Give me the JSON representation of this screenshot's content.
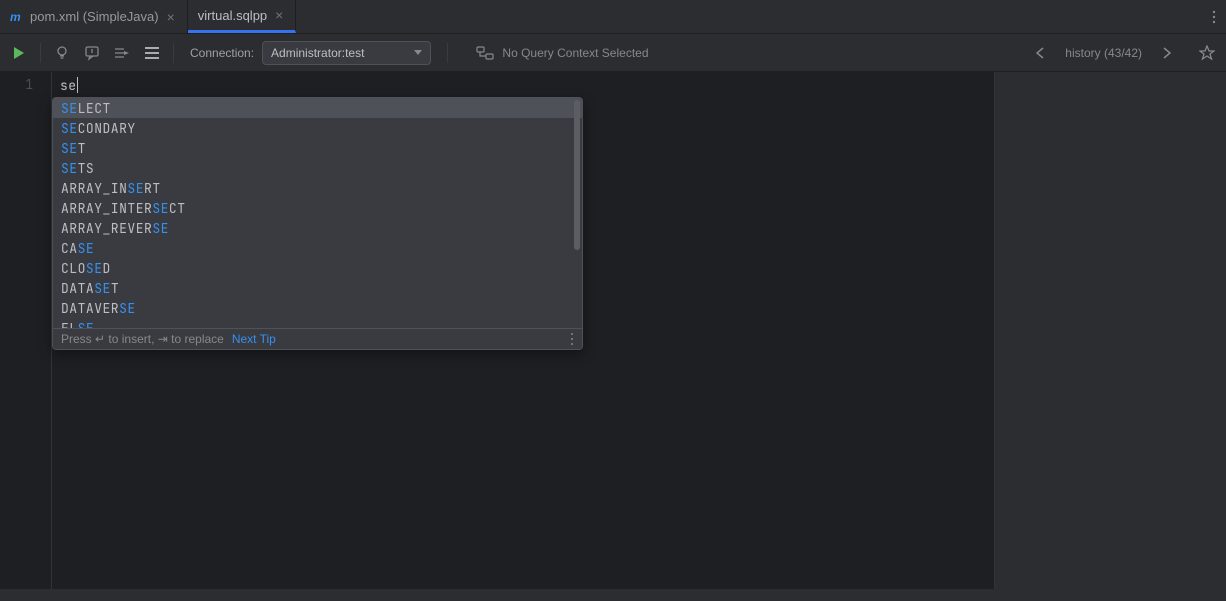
{
  "tabs": {
    "t1": {
      "icon": "maven-icon",
      "label": "pom.xml (SimpleJava)"
    },
    "t2": {
      "icon": "file-icon",
      "label": "virtual.sqlpp"
    }
  },
  "toolbar": {
    "connection_label": "Connection:",
    "connection_value": "Administrator:test",
    "no_context": "No Query Context Selected",
    "history": "history (43/42)"
  },
  "editor": {
    "line_number": "1",
    "typed": "se"
  },
  "autocomplete": {
    "items": [
      {
        "pre": "",
        "match": "SE",
        "post": "LECT"
      },
      {
        "pre": "",
        "match": "SE",
        "post": "CONDARY"
      },
      {
        "pre": "",
        "match": "SE",
        "post": "T"
      },
      {
        "pre": "",
        "match": "SE",
        "post": "TS"
      },
      {
        "pre": "ARRAY_IN",
        "match": "SE",
        "post": "RT"
      },
      {
        "pre": "ARRAY_INTER",
        "match": "SE",
        "post": "CT"
      },
      {
        "pre": "ARRAY_REVER",
        "match": "SE",
        "post": ""
      },
      {
        "pre": "CA",
        "match": "SE",
        "post": ""
      },
      {
        "pre": "CLO",
        "match": "SE",
        "post": "D"
      },
      {
        "pre": "DATA",
        "match": "SE",
        "post": "T"
      },
      {
        "pre": "DATAVER",
        "match": "SE",
        "post": ""
      },
      {
        "pre": "EL",
        "match": "SE",
        "post": ""
      }
    ],
    "footer_insert": "Press ↵ to insert, ⇥ to replace",
    "footer_next": "Next Tip"
  }
}
